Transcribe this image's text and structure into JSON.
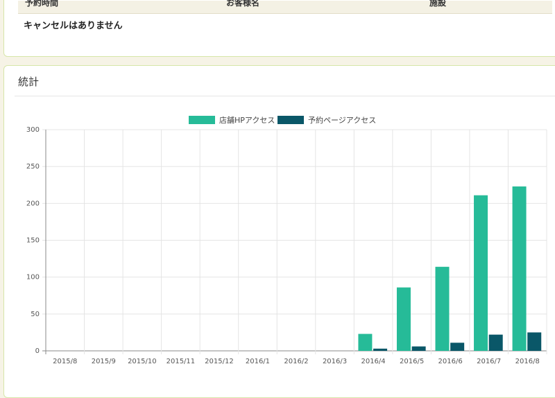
{
  "reservations": {
    "columns": [
      "予約時間",
      "お客様名",
      "施設"
    ],
    "empty_message": "キャンセルはありません"
  },
  "stats": {
    "title": "統計"
  },
  "colors": {
    "store_hp": "#26bb98",
    "reserve_page": "#0a5768"
  },
  "chart_data": {
    "type": "bar",
    "categories": [
      "2015/8",
      "2015/9",
      "2015/10",
      "2015/11",
      "2015/12",
      "2016/1",
      "2016/2",
      "2016/3",
      "2016/4",
      "2016/5",
      "2016/6",
      "2016/7",
      "2016/8"
    ],
    "series": [
      {
        "name": "店舗HPアクセス",
        "values": [
          0,
          0,
          0,
          0,
          0,
          0,
          0,
          0,
          23,
          86,
          114,
          211,
          223
        ]
      },
      {
        "name": "予約ページアクセス",
        "values": [
          0,
          0,
          0,
          0,
          0,
          0,
          0,
          0,
          3,
          6,
          11,
          22,
          25
        ]
      }
    ],
    "ylim": [
      0,
      300
    ],
    "yticks": [
      0,
      50,
      100,
      150,
      200,
      250,
      300
    ],
    "grid": true,
    "legend": "top-center"
  }
}
